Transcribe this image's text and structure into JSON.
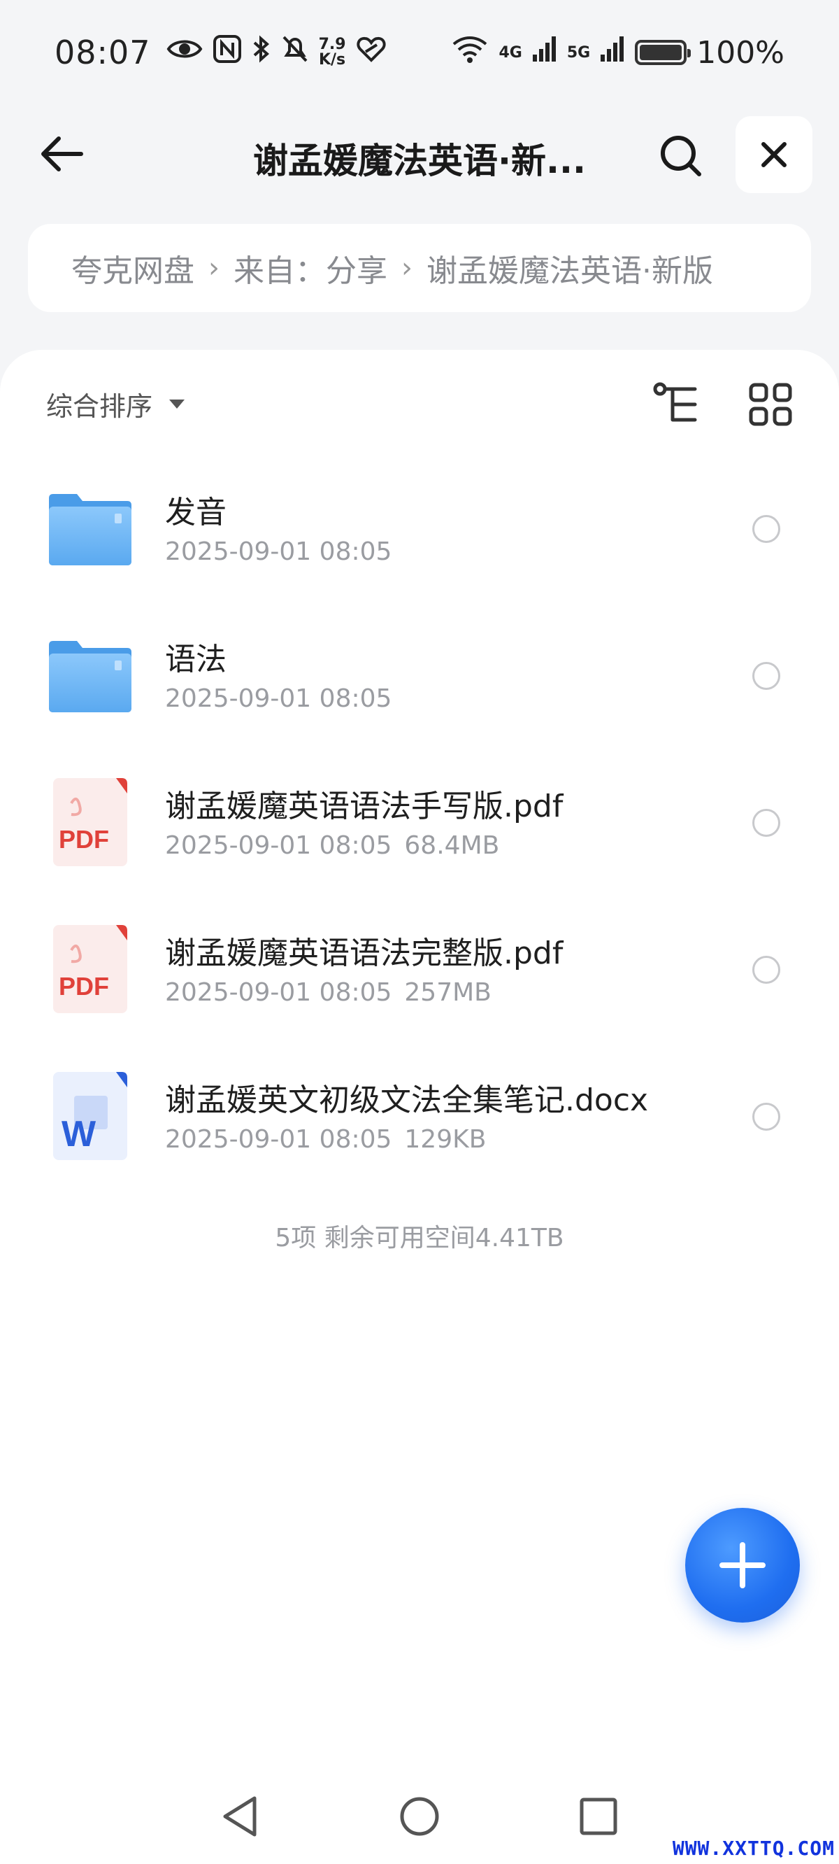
{
  "status_bar": {
    "time": "08:07",
    "speed_value": "7.9",
    "speed_unit": "K/s",
    "net_4g": "4G",
    "net_5g": "5G",
    "battery_pct": "100%",
    "battery_level": 1.0
  },
  "header": {
    "title": "谢孟媛魔法英语·新..."
  },
  "breadcrumb": {
    "items": [
      "夸克网盘",
      "来自：分享",
      "谢孟媛魔法英语·新版"
    ],
    "separator": "›"
  },
  "toolbar": {
    "sort_label": "综合排序"
  },
  "files": [
    {
      "name": "发音",
      "date": "2025-09-01 08:05",
      "size": "",
      "type": "folder"
    },
    {
      "name": "语法",
      "date": "2025-09-01 08:05",
      "size": "",
      "type": "folder"
    },
    {
      "name": "谢孟媛魔英语语法手写版.pdf",
      "date": "2025-09-01 08:05",
      "size": "68.4MB",
      "type": "pdf",
      "icon_text": "PDF"
    },
    {
      "name": "谢孟媛魔英语语法完整版.pdf",
      "date": "2025-09-01 08:05",
      "size": "257MB",
      "type": "pdf",
      "icon_text": "PDF"
    },
    {
      "name": "谢孟媛英文初级文法全集笔记.docx",
      "date": "2025-09-01 08:05",
      "size": "129KB",
      "type": "docx",
      "icon_text": "W"
    }
  ],
  "summary": "5项 剩余可用空间4.41TB",
  "watermark": "WWW.XXTTQ.COM",
  "colors": {
    "accent": "#1f6ef0",
    "folder": "#5aa9f0",
    "pdf_red": "#e0413a",
    "word_blue": "#2b5fd9",
    "muted_text": "#9a9ca1"
  }
}
